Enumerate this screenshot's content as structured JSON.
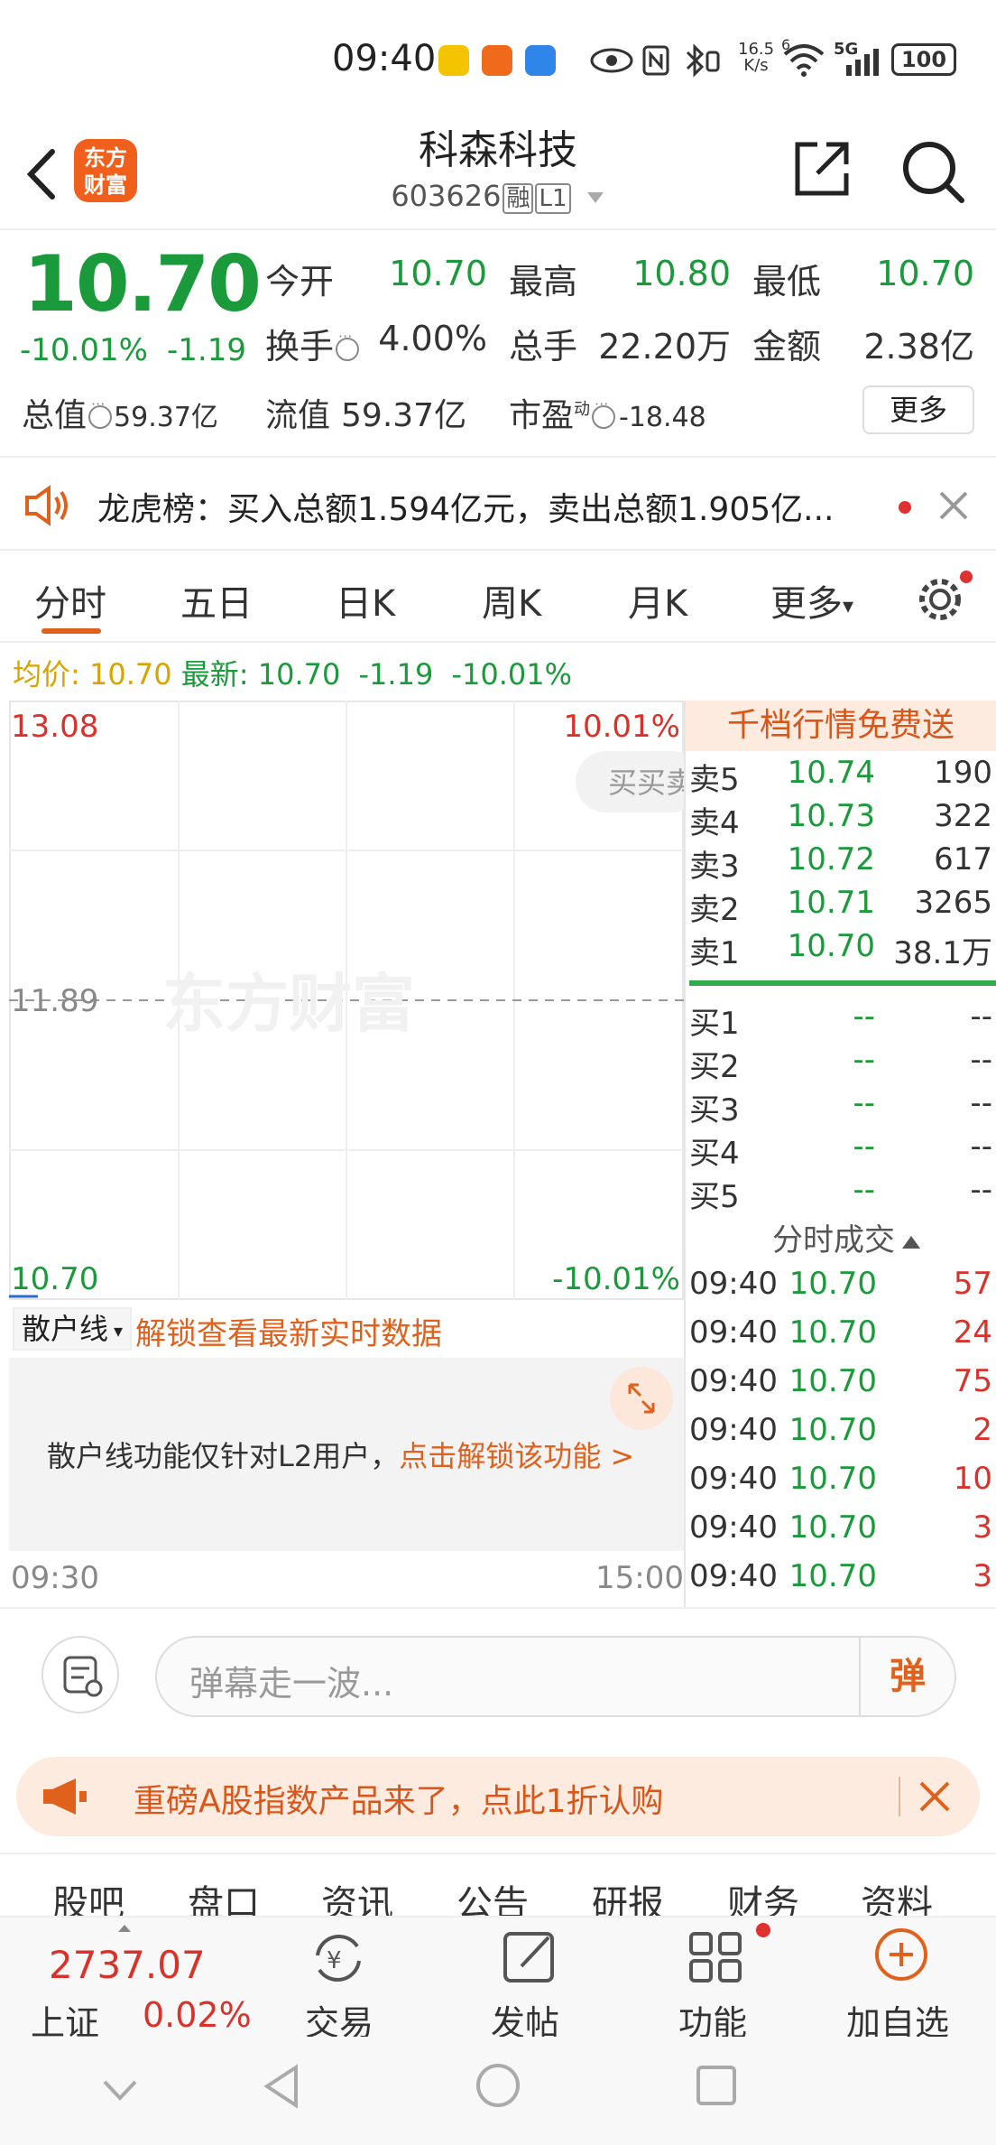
{
  "status_bar": {
    "time": "09:40",
    "net_speed_top": "16.5",
    "net_speed_bottom": "K/s",
    "signal": "5G",
    "signal_sup": "6",
    "battery": "100"
  },
  "header": {
    "logo_line1": "东方",
    "logo_line2": "财富",
    "stock_name": "科森科技",
    "stock_code": "603626",
    "tag_rong": "融",
    "tag_level": "L1"
  },
  "quote": {
    "price": "10.70",
    "change_pct": "-10.01%",
    "change_amt": "-1.19",
    "open_label": "今开",
    "open_value": "10.70",
    "high_label": "最高",
    "high_value": "10.80",
    "low_label": "最低",
    "low_value": "10.70",
    "turnover_label": "换手",
    "turnover_value": "4.00%",
    "volume_label": "总手",
    "volume_value": "22.20万",
    "amount_label": "金额",
    "amount_value": "2.38亿",
    "mcap_label": "总值",
    "mcap_value": "59.37亿",
    "float_label": "流值",
    "float_value": "59.37亿",
    "pe_label": "市盈",
    "pe_sup": "动",
    "pe_value": "-18.48",
    "more_label": "更多"
  },
  "lhb": {
    "text": "龙虎榜：买入总额1.594亿元，卖出总额1.905亿..."
  },
  "tabs": [
    "分时",
    "五日",
    "日K",
    "周K",
    "月K",
    "更多"
  ],
  "price_line": {
    "avg_label": "均价:",
    "avg_value": "10.70",
    "latest_label": "最新:",
    "latest_value": "10.70",
    "change_amt": "-1.19",
    "change_pct": "-10.01%"
  },
  "chart": {
    "y_top": "13.08",
    "y_mid": "11.89",
    "y_bottom": "10.70",
    "pct_top": "10.01%",
    "pct_bottom": "-10.01%",
    "watermark": "东方财富",
    "buy_sell_hint": "买买卖",
    "time_start": "09:30",
    "time_end": "15:00"
  },
  "depth": {
    "title": "千档行情免费送",
    "asks": [
      {
        "label": "卖5",
        "price": "10.74",
        "vol": "190"
      },
      {
        "label": "卖4",
        "price": "10.73",
        "vol": "322"
      },
      {
        "label": "卖3",
        "price": "10.72",
        "vol": "617"
      },
      {
        "label": "卖2",
        "price": "10.71",
        "vol": "3265"
      },
      {
        "label": "卖1",
        "price": "10.70",
        "vol": "38.1万"
      }
    ],
    "bids": [
      {
        "label": "买1",
        "price": "--",
        "vol": "--"
      },
      {
        "label": "买2",
        "price": "--",
        "vol": "--"
      },
      {
        "label": "买3",
        "price": "--",
        "vol": "--"
      },
      {
        "label": "买4",
        "price": "--",
        "vol": "--"
      },
      {
        "label": "买5",
        "price": "--",
        "vol": "--"
      }
    ]
  },
  "ticker": {
    "title": "分时成交",
    "rows": [
      {
        "time": "09:40",
        "price": "10.70",
        "vol": "57"
      },
      {
        "time": "09:40",
        "price": "10.70",
        "vol": "24"
      },
      {
        "time": "09:40",
        "price": "10.70",
        "vol": "75"
      },
      {
        "time": "09:40",
        "price": "10.70",
        "vol": "2"
      },
      {
        "time": "09:40",
        "price": "10.70",
        "vol": "10"
      },
      {
        "time": "09:40",
        "price": "10.70",
        "vol": "3"
      },
      {
        "time": "09:40",
        "price": "10.70",
        "vol": "3"
      }
    ]
  },
  "sanhu": {
    "selector": "散户线",
    "unlock_text": "解锁查看最新实时数据",
    "panel_text": "散户线功能仅针对L2用户，",
    "panel_link": "点击解锁该功能 >"
  },
  "danmu": {
    "placeholder": "弹幕走一波...",
    "send": "弹"
  },
  "promo": {
    "text": "重磅A股指数产品来了，点此1折认购"
  },
  "sub_tabs": [
    "股吧",
    "盘口",
    "资讯",
    "公告",
    "研报",
    "财务",
    "资料"
  ],
  "bottom_nav": {
    "index_value": "2737.07",
    "index_name": "上证",
    "index_change": "0.02%",
    "trade": "交易",
    "post": "发帖",
    "functions": "功能",
    "add_watch": "加自选"
  },
  "colors": {
    "green": "#1a9a3a",
    "red": "#d9322b",
    "orange": "#e0611b",
    "gold": "#d9a300"
  }
}
